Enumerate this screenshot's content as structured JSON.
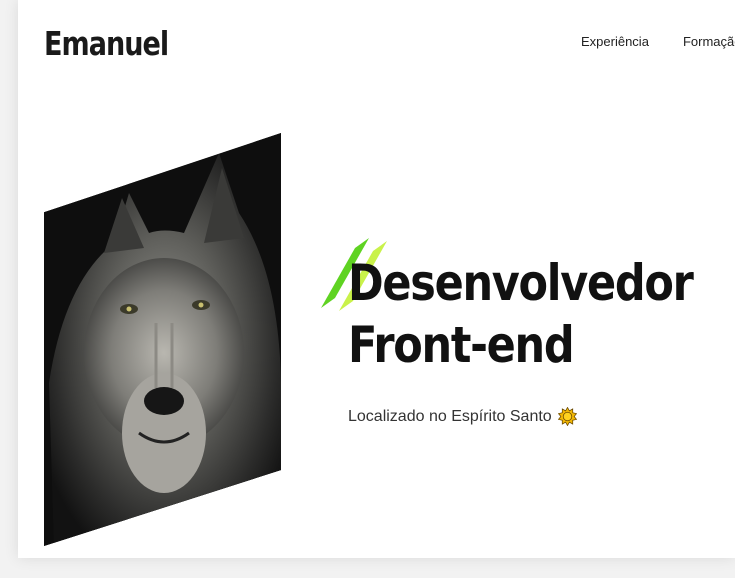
{
  "header": {
    "logo": "Emanuel",
    "nav": [
      {
        "label": "Experiência"
      },
      {
        "label": "Formação"
      }
    ]
  },
  "hero": {
    "photo_icon": "wolf-portrait",
    "title_line1": "Desenvolvedor",
    "title_line2": "Front-end",
    "location": "Localizado no Espírito Santo",
    "location_icon": "sun-emoji",
    "accent_colors": {
      "stripe_dark": "#5fd322",
      "stripe_light": "#c9f24a"
    }
  }
}
